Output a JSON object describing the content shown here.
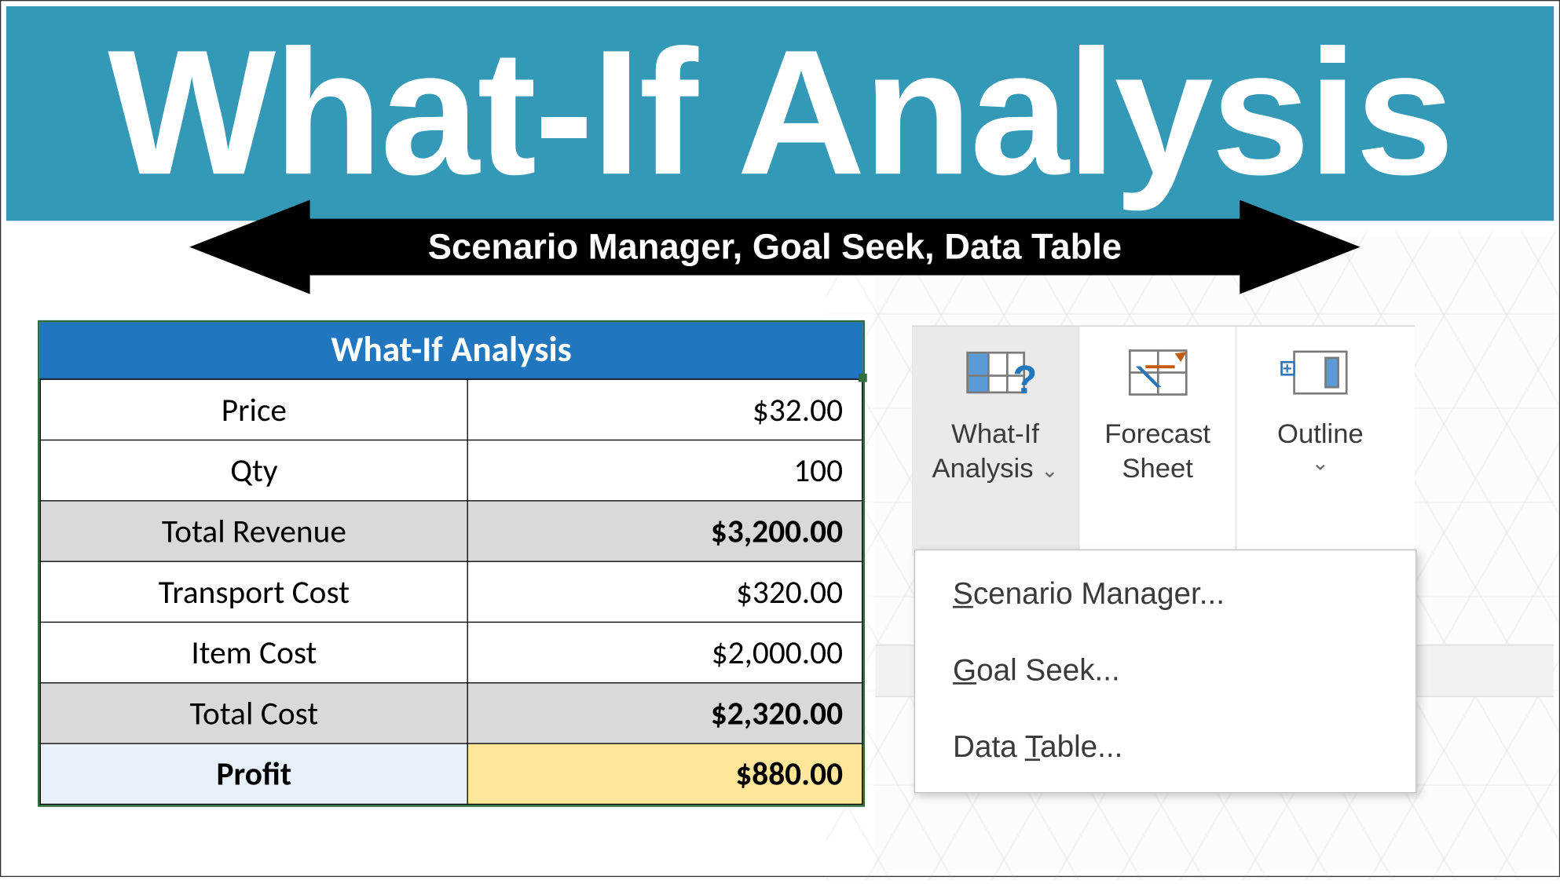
{
  "header": {
    "title": "What-If Analysis",
    "subtitle": "Scenario Manager, Goal Seek, Data Table"
  },
  "table": {
    "header": "What-If Analysis",
    "rows": [
      {
        "label": "Price",
        "value": "$32.00",
        "style": "plain"
      },
      {
        "label": "Qty",
        "value": "100",
        "style": "plain"
      },
      {
        "label": "Total Revenue",
        "value": "$3,200.00",
        "style": "shade"
      },
      {
        "label": "Transport Cost",
        "value": "$320.00",
        "style": "plain"
      },
      {
        "label": "Item Cost",
        "value": "$2,000.00",
        "style": "plain"
      },
      {
        "label": "Total Cost",
        "value": "$2,320.00",
        "style": "shade"
      },
      {
        "label": "Profit",
        "value": "$880.00",
        "style": "profit"
      }
    ]
  },
  "ribbon": {
    "whatif_line1": "What-If",
    "whatif_line2": "Analysis",
    "forecast_line1": "Forecast",
    "forecast_line2": "Sheet",
    "outline": "Outline"
  },
  "dropdown": {
    "items": [
      {
        "pre": "",
        "ul": "S",
        "post": "cenario Manager..."
      },
      {
        "pre": "",
        "ul": "G",
        "post": "oal Seek..."
      },
      {
        "pre": "Data ",
        "ul": "T",
        "post": "able..."
      }
    ]
  }
}
